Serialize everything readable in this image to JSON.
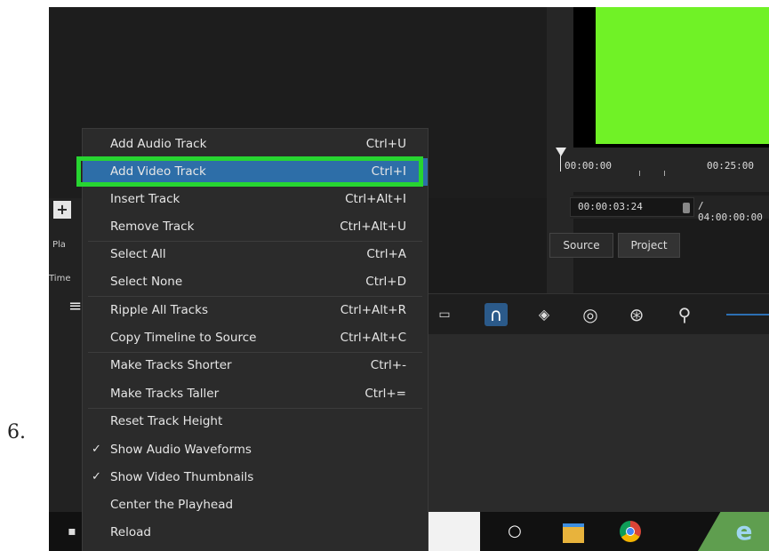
{
  "step_number": "6.",
  "left_stubs": {
    "play": "Pla",
    "time": "Time",
    "menu_icon": "≡"
  },
  "menu": {
    "items": [
      {
        "label": "Add Audio Track",
        "shortcut": "Ctrl+U",
        "check": ""
      },
      {
        "label": "Add Video Track",
        "shortcut": "Ctrl+I",
        "check": "",
        "active": true
      },
      {
        "label": "Insert Track",
        "shortcut": "Ctrl+Alt+I",
        "check": ""
      },
      {
        "label": "Remove Track",
        "shortcut": "Ctrl+Alt+U",
        "check": ""
      },
      {
        "label": "Select All",
        "shortcut": "Ctrl+A",
        "check": ""
      },
      {
        "label": "Select None",
        "shortcut": "Ctrl+D",
        "check": ""
      },
      {
        "label": "Ripple All Tracks",
        "shortcut": "Ctrl+Alt+R",
        "check": ""
      },
      {
        "label": "Copy Timeline to Source",
        "shortcut": "Ctrl+Alt+C",
        "check": ""
      },
      {
        "label": "Make Tracks Shorter",
        "shortcut": "Ctrl+-",
        "check": ""
      },
      {
        "label": "Make Tracks Taller",
        "shortcut": "Ctrl+=",
        "check": ""
      },
      {
        "label": "Reset Track Height",
        "shortcut": "",
        "check": ""
      },
      {
        "label": "Show Audio Waveforms",
        "shortcut": "",
        "check": "✓"
      },
      {
        "label": "Show Video Thumbnails",
        "shortcut": "",
        "check": "✓"
      },
      {
        "label": "Center the Playhead",
        "shortcut": "",
        "check": ""
      },
      {
        "label": "Reload",
        "shortcut": "",
        "check": ""
      }
    ]
  },
  "ruler": {
    "start": "00:00:00",
    "end": "00:25:00"
  },
  "timecode": {
    "current": "00:00:03:24",
    "total": "/ 04:00:00:00"
  },
  "tabs": {
    "source": "Source",
    "project": "Project"
  },
  "colors": {
    "highlight": "#27d531",
    "selected": "#2d6ea8",
    "preview": "#70f226"
  },
  "toolbar_icons": [
    "split-icon",
    "snap-magnet-icon",
    "scrub-audio-icon",
    "ripple-icon",
    "ripple-all-icon",
    "zoom-out-icon"
  ]
}
